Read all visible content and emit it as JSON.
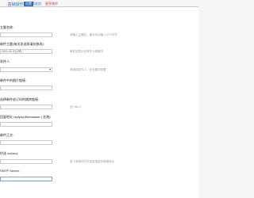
{
  "header": {
    "title": "·基础操作",
    "nav": {
      "basic": "设置",
      "mail": "群发信",
      "advanced": "更多操作"
    }
  },
  "form": {
    "fields": [
      {
        "label": "主题名称:",
        "value": "",
        "hint": "请输入主题名，最多可以输入20个字符"
      },
      {
        "label": "邮件主题(每次发送前请勿修改):",
        "value": "2021-03-01(1号)",
        "hint": "邮件将显示在收件人邮箱中"
      },
      {
        "label": "发件人:",
        "value": "",
        "hint": "请选择发件人，在设置中配置"
      },
      {
        "label": "邮件中的图片链接:",
        "value": "",
        "hint": ""
      },
      {
        "label": "选择邮件退订时的跳转链接:",
        "value": "",
        "hint": "如: http://"
      },
      {
        "label": "回复地址 replyto(Webmaster | 名称):",
        "value": "",
        "hint": ""
      },
      {
        "label": "邮件正文:",
        "value": "",
        "hint": ""
      },
      {
        "label": "抄送 cc(bcc):",
        "value": "",
        "hint": "用于发邮件时抄送给指定的邮箱地址"
      },
      {
        "label": "SMTP Secret:",
        "value": "",
        "hint": ""
      }
    ]
  }
}
